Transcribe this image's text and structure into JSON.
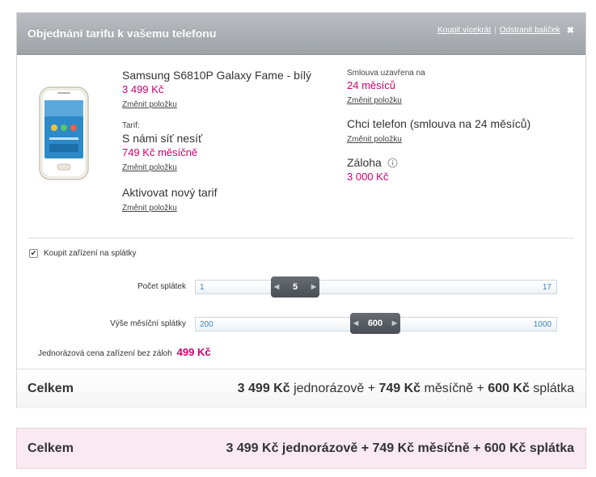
{
  "header": {
    "title": "Objednání tarifu k vašemu telefonu",
    "buy_more_link": "Koupit vícekrát",
    "separator": "|",
    "remove_package_link": "Odstranit balíček",
    "close_symbol": "✖"
  },
  "product": {
    "name": "Samsung S6810P Galaxy Fame - bílý",
    "price": "3 499 Kč",
    "change_label": "Změnit položku"
  },
  "tariff": {
    "label": "Tarif:",
    "name": "S námi síť nesíť",
    "price": "749 Kč měsíčně",
    "change_label": "Změnit položku"
  },
  "activation": {
    "name": "Aktivovat nový tarif",
    "change_label": "Změnit položku"
  },
  "contract": {
    "label": "Smlouva uzavřena na",
    "value": "24 měsíců",
    "change_label": "Změnit položku"
  },
  "phone_option": {
    "name": "Chci telefon (smlouva na 24 měsíců)",
    "change_label": "Změnit položku"
  },
  "deposit": {
    "label": "Záloha",
    "info_icon": "info-icon",
    "value": "3 000 Kč"
  },
  "installments": {
    "checkbox_label": "Koupit zařízení na splátky",
    "checked": true,
    "count_slider": {
      "label": "Počet splátek",
      "min": "1",
      "max": "17",
      "value": "5"
    },
    "amount_slider": {
      "label": "Výše měsíční splátky",
      "min": "200",
      "max": "1000",
      "value": "600"
    },
    "onetime_label": "Jednorázová cena zařízení bez záloh",
    "onetime_value": "499 Kč"
  },
  "total": {
    "label": "Celkem",
    "onetime_amount": "3 499 Kč",
    "onetime_word": "jednorázově",
    "plus": "+",
    "monthly_amount": "749 Kč",
    "monthly_word": "měsíčně",
    "installment_amount": "600 Kč",
    "installment_word": "splátka"
  },
  "total_pink": {
    "label": "Celkem",
    "text": "3 499 Kč jednorázově + 749 Kč měsíčně + 600 Kč splátka"
  },
  "colors": {
    "accent": "#d0006f",
    "header_bg": "#a9aeb2",
    "pink_bg": "#f9e9f1"
  }
}
